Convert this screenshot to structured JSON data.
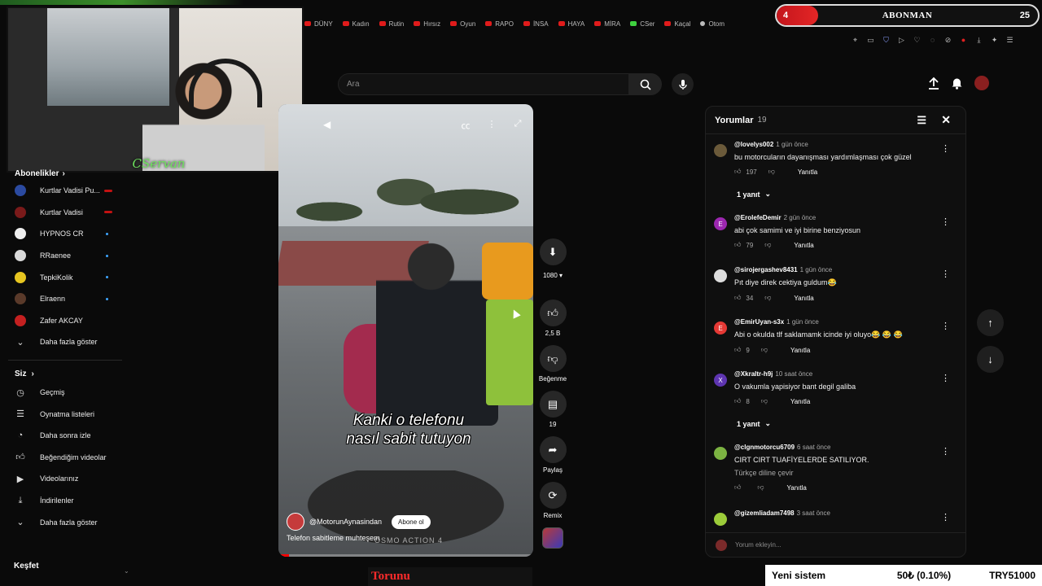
{
  "browser": {
    "tabs": [
      {
        "label": "DÜNY",
        "color": "red"
      },
      {
        "label": "Kadın",
        "color": "red"
      },
      {
        "label": "Rutin",
        "color": "red"
      },
      {
        "label": "Hırsız",
        "color": "red"
      },
      {
        "label": "Oyun",
        "color": "red"
      },
      {
        "label": "RAPO",
        "color": "red"
      },
      {
        "label": "İNSA",
        "color": "red"
      },
      {
        "label": "HAYA",
        "color": "red"
      },
      {
        "label": "MİRA",
        "color": "red"
      },
      {
        "label": "CSer",
        "color": "green"
      },
      {
        "label": "Kaçal",
        "color": "red"
      },
      {
        "label": "Otom",
        "color": "gray"
      }
    ]
  },
  "overlay": {
    "sub_goal": {
      "current": "4",
      "label": "ABONMAN",
      "target": "25",
      "progress": 0.16
    },
    "webcam_name": "CServan",
    "bottom_banner": "Torunu",
    "ticker": {
      "left": "Yeni sistem",
      "middle": "50₺ (0.10%)",
      "right": "TRY51000"
    }
  },
  "sidebar": {
    "subscriptions_heading": "Abonelikler",
    "channels": [
      {
        "name": "Kurtlar Vadisi Pu...",
        "indicator": "live",
        "color": "#2b4aa0"
      },
      {
        "name": "Kurtlar Vadisi",
        "indicator": "live",
        "color": "#7a1a1a"
      },
      {
        "name": "HYPNOS CR",
        "indicator": "new",
        "color": "#eeeeee"
      },
      {
        "name": "RRaenee",
        "indicator": "new",
        "color": "#d9d9d9"
      },
      {
        "name": "TepkiKolik",
        "indicator": "new",
        "color": "#e6c520"
      },
      {
        "name": "Elraenn",
        "indicator": "new",
        "color": "#5a3a2a"
      },
      {
        "name": "Zafer AKCAY",
        "indicator": "none",
        "color": "#c42020"
      }
    ],
    "show_more": "Daha fazla göster",
    "you_heading": "Siz",
    "you_items": [
      {
        "label": "Geçmiş",
        "icon": "history-icon"
      },
      {
        "label": "Oynatma listeleri",
        "icon": "playlist-icon"
      },
      {
        "label": "Daha sonra izle",
        "icon": "clock-icon"
      },
      {
        "label": "Beğendiğim videolar",
        "icon": "thumbs-up-icon"
      },
      {
        "label": "Videolarınız",
        "icon": "video-icon"
      },
      {
        "label": "İndirilenler",
        "icon": "download-icon"
      },
      {
        "label": "Daha fazla göster",
        "icon": "chevron-down-icon"
      }
    ],
    "explore_heading": "Keşfet"
  },
  "search": {
    "placeholder": "Ara"
  },
  "video": {
    "caption_line1": "Kanki o telefonu",
    "caption_line2": "nasıl sabit tutuyon",
    "channel": "@MotorunAynasindan",
    "subscribe": "Abone ol",
    "description": "Telefon sabitleme muhteşem",
    "watermark": "OSMO ACTION 4",
    "progress": 0.04
  },
  "actions": {
    "quality": "1080",
    "likes": "2,5 B",
    "dislike": "Beğenme",
    "comments": "19",
    "share": "Paylaş",
    "remix": "Remix"
  },
  "comments": {
    "title": "Yorumlar",
    "count": "19",
    "add_placeholder": "Yorum ekleyin...",
    "items": [
      {
        "user": "@lovelys002",
        "time": "1 gün önce",
        "text": "bu motorcuların dayanışması yardımlaşması çok güzel",
        "likes": "197",
        "reply": "Yanıtla",
        "avatar_color": "#6b5a3a",
        "avatar_letter": "",
        "replies": "1 yanıt"
      },
      {
        "user": "@ErolefeDemir",
        "time": "2 gün önce",
        "text": "abi çok samimi ve iyi birine benziyosun",
        "likes": "79",
        "reply": "Yanıtla",
        "avatar_color": "#9c27b0",
        "avatar_letter": "E",
        "replies": ""
      },
      {
        "user": "@sirojergashev8431",
        "time": "1 gün önce",
        "text": "Pıt diye direk cektiya guldum😂",
        "likes": "34",
        "reply": "Yanıtla",
        "avatar_color": "#dddddd",
        "avatar_letter": "",
        "replies": ""
      },
      {
        "user": "@EmirUyan-s3x",
        "time": "1 gün önce",
        "text": "Abi o okulda tlf saklamamk icinde iyi oluyo😂 😂 😂",
        "likes": "9",
        "reply": "Yanıtla",
        "avatar_color": "#e53935",
        "avatar_letter": "E",
        "replies": ""
      },
      {
        "user": "@Xkraltr-h9j",
        "time": "10 saat önce",
        "text": "O vakumla yapisiyor bant degil galiba",
        "likes": "8",
        "reply": "Yanıtla",
        "avatar_color": "#5e35b1",
        "avatar_letter": "X",
        "replies": "1 yanıt"
      },
      {
        "user": "@clgnmotorcu6709",
        "time": "6 saat önce",
        "text": "CIRT CIRT TUAFİYELERDE SATILIYOR.",
        "translate": "Türkçe diline çevir",
        "likes": "",
        "reply": "Yanıtla",
        "avatar_color": "#7cb342",
        "avatar_letter": "",
        "replies": ""
      },
      {
        "user": "@gizemliadam7498",
        "time": "3 saat önce",
        "text": "",
        "likes": "",
        "reply": "",
        "avatar_color": "#9ccc3a",
        "avatar_letter": "",
        "replies": ""
      }
    ]
  }
}
